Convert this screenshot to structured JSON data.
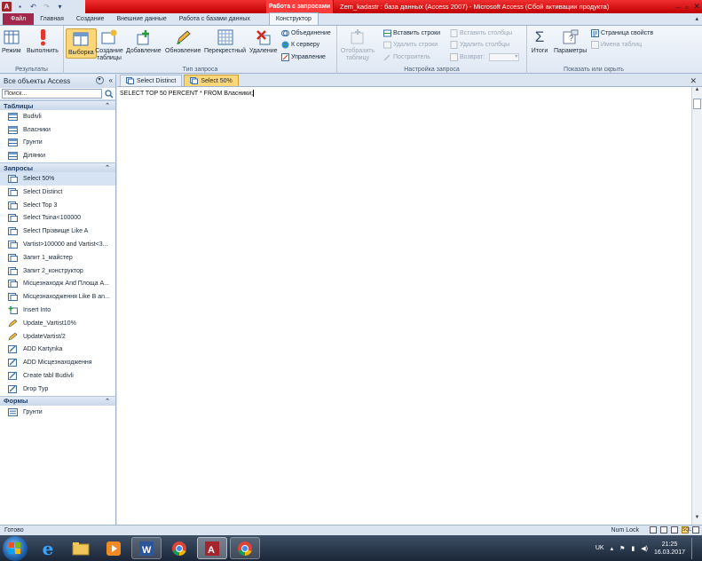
{
  "window": {
    "context_group": "Работа с запросами",
    "title": "Zem_kadastr : база данных (Access 2007)  -  Microsoft Access (Сбой активации продукта)"
  },
  "ribbon_tabs": [
    "Файл",
    "Главная",
    "Создание",
    "Внешние данные",
    "Работа с базами данных"
  ],
  "context_tab": "Конструктор",
  "ribbon": {
    "results": {
      "label": "Результаты",
      "mode": "Режим",
      "run": "Выполнить"
    },
    "query_type": {
      "label": "Тип запроса",
      "select": "Выборка",
      "make_table": "Создание таблицы",
      "append": "Добавление",
      "update": "Обновление",
      "crosstab": "Перекрестный",
      "delete": "Удаление",
      "union": "Объединение",
      "passthrough": "К серверу",
      "ddl": "Управление"
    },
    "setup": {
      "label": "Настройка запроса",
      "show_table": "Отобразить таблицу",
      "insert_rows": "Вставить строки",
      "delete_rows": "Удалить строки",
      "builder": "Построитель",
      "insert_cols": "Вставить столбцы",
      "delete_cols": "Удалить столбцы",
      "return": "Возврат:"
    },
    "show_hide": {
      "label": "Показать или скрыть",
      "totals": "Итоги",
      "params": "Параметры",
      "prop_sheet": "Страница свойств",
      "table_names": "Имена таблиц"
    }
  },
  "nav": {
    "header": "Все объекты Access",
    "search_placeholder": "Поиск...",
    "sections": [
      {
        "title": "Таблицы",
        "items": [
          "Budivli",
          "Власники",
          "Грунти",
          "Ділянки"
        ]
      },
      {
        "title": "Запросы",
        "items": [
          "Select 50%",
          "Select Distinct",
          "Select Top 3",
          "Select Tsina<100000",
          "Select Прізвище Like A",
          "Vartist>100000 and Vartist<3...",
          "Запит 1_майстер",
          "Запит 2_конструктор",
          "Місцезнаходж And Площа A...",
          "Місцезнаходження Like B an...",
          "Insert Into",
          "Update_Vartist10%",
          "UpdateVartist/2",
          "ADD Kartynka",
          "ADD Місцезнаходження",
          "Create tabl Budivli",
          "Drop Typ"
        ]
      },
      {
        "title": "Формы",
        "items": [
          "Грунти"
        ]
      }
    ]
  },
  "doc_tabs": [
    "Select Distinct",
    "Select 50%"
  ],
  "editor": {
    "sql": "SELECT TOP 50 PERCENT * FROM Власники;"
  },
  "status": {
    "left": "Готово",
    "num_lock": "Num Lock"
  },
  "tray": {
    "lang": "UK",
    "time": "21:25",
    "date": "16.03.2017"
  }
}
